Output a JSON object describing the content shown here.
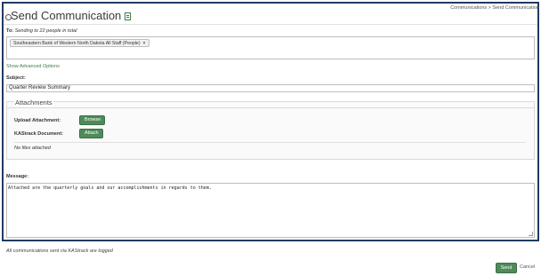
{
  "header": {
    "title": "Send Communication",
    "breadcrumb": "Communications > Send Communication"
  },
  "to": {
    "label": "To:",
    "count_text": "Sending to 22 people in total",
    "recipients": [
      {
        "label": "Southeastern Bank of Western North Dakota All Staff (People)",
        "remove": "×"
      }
    ]
  },
  "advanced_link": "Show Advanced Options",
  "subject": {
    "label": "Subject:",
    "value": "Quarter Review Summary"
  },
  "attachments": {
    "legend": "Attachments",
    "upload_label": "Upload Attachment:",
    "browse_label": "Browse",
    "kastrack_label": "KAStrack Document:",
    "attach_label": "Attach",
    "empty_text": "No files attached"
  },
  "message": {
    "label": "Message:",
    "value": "Attached are the quarterly goals and our accomplishments in regards to them."
  },
  "footer": {
    "logged_note": "All communications sent via KAStrack are logged",
    "send_label": "Send",
    "cancel_label": "Cancel"
  },
  "colors": {
    "accent_green": "#4e8a5a",
    "frame_border": "#1f3b63",
    "link_green": "#3f7d4a"
  },
  "icons": {
    "title_icon": "document-icon",
    "tag_remove_icon": "close-icon"
  }
}
